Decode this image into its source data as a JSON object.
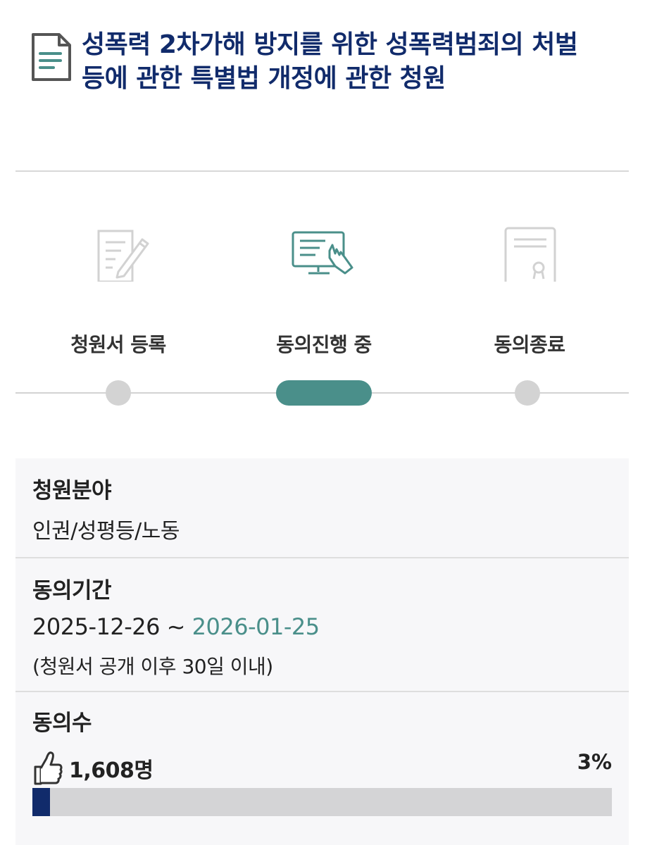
{
  "title": "성폭력 2차가해 방지를 위한 성폭력범죄의 처벌 등에 관한 특별법 개정에 관한 청원",
  "steps": [
    {
      "label": "청원서 등록",
      "icon": "pen-document-icon",
      "state": "done"
    },
    {
      "label": "동의진행 중",
      "icon": "monitor-touch-icon",
      "state": "active"
    },
    {
      "label": "동의종료",
      "icon": "certificate-icon",
      "state": "pending"
    }
  ],
  "colors": {
    "title": "#112b6b",
    "accent": "#4a8f8a",
    "bar_fill": "#112b6b",
    "inactive": "#d3d3d3"
  },
  "info": {
    "field": {
      "label": "청원분야",
      "value": "인권/성평등/노동"
    },
    "period": {
      "label": "동의기간",
      "start": "2025-12-26",
      "separator": " ~ ",
      "end": "2026-01-25",
      "note": "(청원서 공개 이후 30일 이내)"
    },
    "count": {
      "label": "동의수",
      "value": "1,608명",
      "percent_text": "3%",
      "progress_fraction": 0.03,
      "icon": "thumbs-up-icon"
    }
  }
}
